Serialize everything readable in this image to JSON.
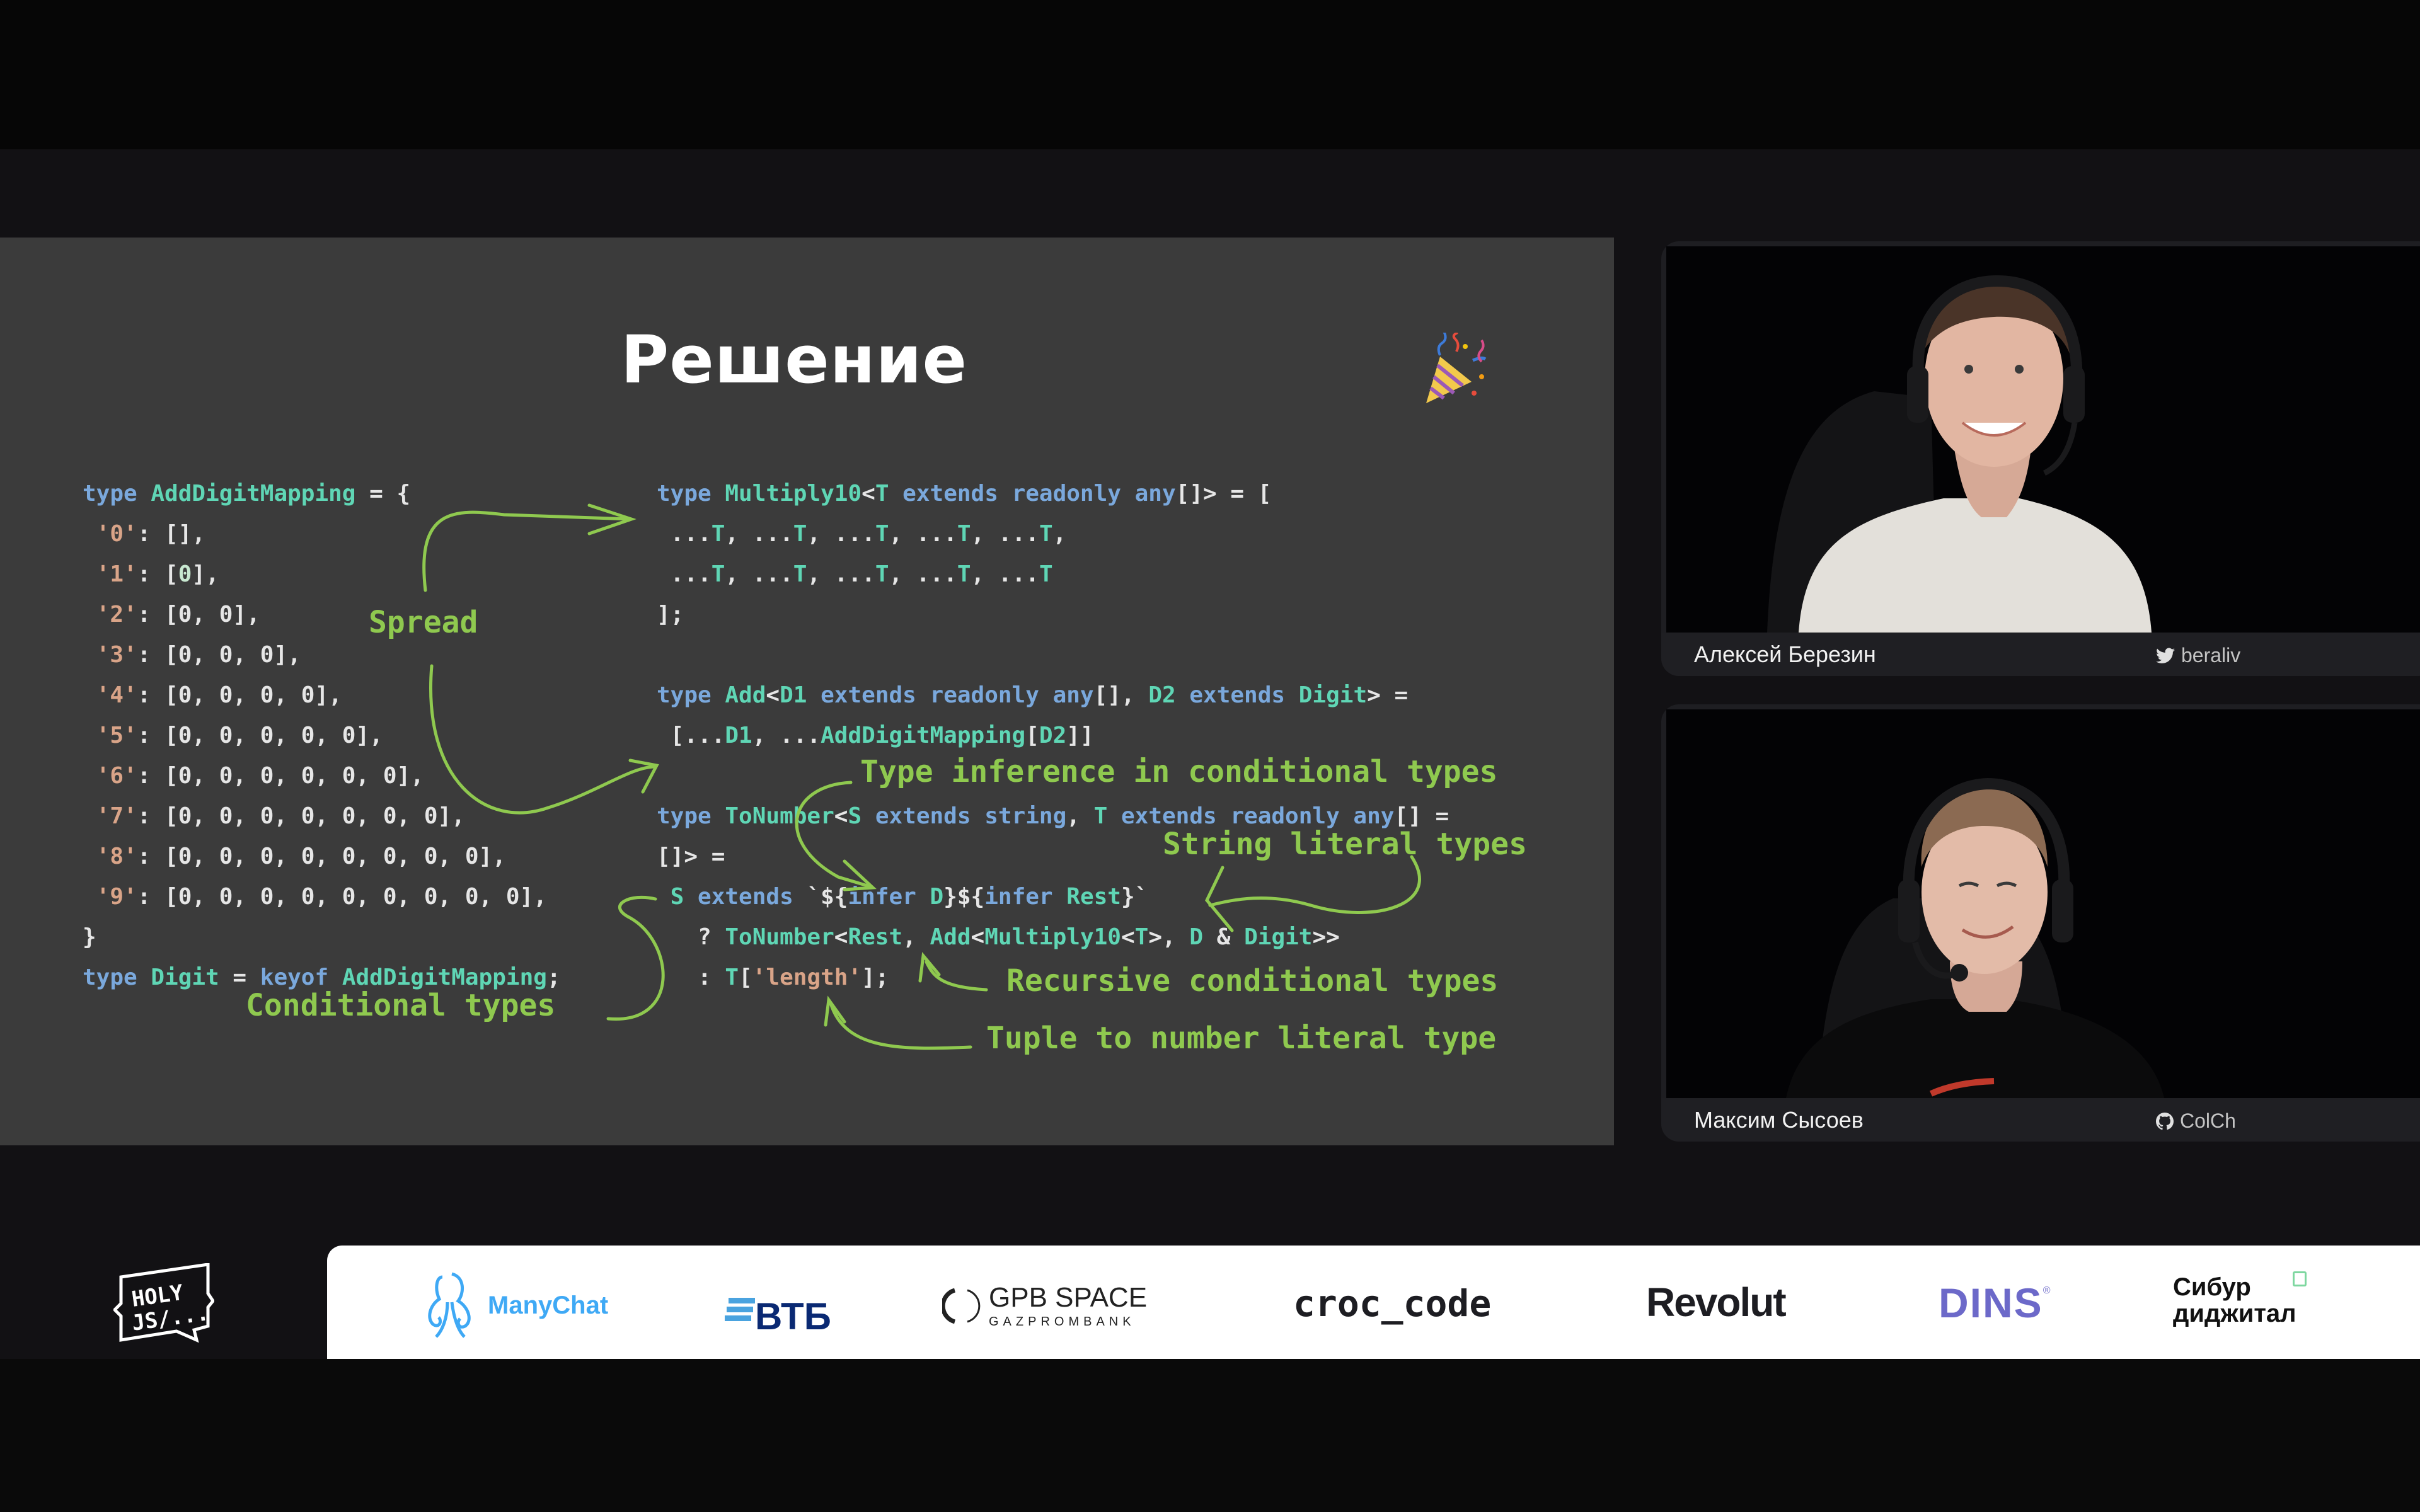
{
  "slide": {
    "title": "Решение",
    "title_icon": "party-popper-icon",
    "left_code": [
      [
        [
          "kw",
          "type "
        ],
        [
          "ty",
          "AddDigitMapping"
        ],
        [
          "tx",
          " = {"
        ]
      ],
      [
        [
          "st",
          " '0'"
        ],
        [
          "tx",
          ": [],"
        ]
      ],
      [
        [
          "st",
          " '1'"
        ],
        [
          "tx",
          ": ["
        ],
        [
          "zr",
          "0"
        ],
        [
          "tx",
          "],"
        ]
      ],
      [
        [
          "st",
          " '2'"
        ],
        [
          "tx",
          ": [0, 0],"
        ]
      ],
      [
        [
          "st",
          " '3'"
        ],
        [
          "tx",
          ": [0, 0, 0],"
        ]
      ],
      [
        [
          "st",
          " '4'"
        ],
        [
          "tx",
          ": [0, 0, 0, 0],"
        ]
      ],
      [
        [
          "st",
          " '5'"
        ],
        [
          "tx",
          ": [0, 0, 0, 0, 0],"
        ]
      ],
      [
        [
          "st",
          " '6'"
        ],
        [
          "tx",
          ": [0, 0, 0, 0, 0, 0],"
        ]
      ],
      [
        [
          "st",
          " '7'"
        ],
        [
          "tx",
          ": [0, 0, 0, 0, 0, 0, 0],"
        ]
      ],
      [
        [
          "st",
          " '8'"
        ],
        [
          "tx",
          ": [0, 0, 0, 0, 0, 0, 0, 0],"
        ]
      ],
      [
        [
          "st",
          " '9'"
        ],
        [
          "tx",
          ": [0, 0, 0, 0, 0, 0, 0, 0, 0],"
        ]
      ],
      [
        [
          "tx",
          "}"
        ]
      ],
      [
        [
          "kw",
          "type "
        ],
        [
          "ty",
          "Digit"
        ],
        [
          "tx",
          " = "
        ],
        [
          "kw",
          "keyof "
        ],
        [
          "ty",
          "AddDigitMapping"
        ],
        [
          "tx",
          ";"
        ]
      ]
    ],
    "multiply_code": [
      [
        [
          "kw",
          "type "
        ],
        [
          "ty",
          "Multiply10"
        ],
        [
          "tx",
          "<"
        ],
        [
          "ty",
          "T"
        ],
        [
          "kw",
          " extends readonly any"
        ],
        [
          "tx",
          "[]> = ["
        ]
      ],
      [
        [
          "tx",
          " ..."
        ],
        [
          "ty",
          "T"
        ],
        [
          "tx",
          ", ..."
        ],
        [
          "ty",
          "T"
        ],
        [
          "tx",
          ", ..."
        ],
        [
          "ty",
          "T"
        ],
        [
          "tx",
          ", ..."
        ],
        [
          "ty",
          "T"
        ],
        [
          "tx",
          ", ..."
        ],
        [
          "ty",
          "T"
        ],
        [
          "tx",
          ","
        ]
      ],
      [
        [
          "tx",
          " ..."
        ],
        [
          "ty",
          "T"
        ],
        [
          "tx",
          ", ..."
        ],
        [
          "ty",
          "T"
        ],
        [
          "tx",
          ", ..."
        ],
        [
          "ty",
          "T"
        ],
        [
          "tx",
          ", ..."
        ],
        [
          "ty",
          "T"
        ],
        [
          "tx",
          ", ..."
        ],
        [
          "ty",
          "T"
        ]
      ],
      [
        [
          "tx",
          "];"
        ]
      ]
    ],
    "add_code": [
      [
        [
          "kw",
          "type "
        ],
        [
          "ty",
          "Add"
        ],
        [
          "tx",
          "<"
        ],
        [
          "ty",
          "D1"
        ],
        [
          "kw",
          " extends readonly any"
        ],
        [
          "tx",
          "[], "
        ],
        [
          "ty",
          "D2"
        ],
        [
          "kw",
          " extends "
        ],
        [
          "ty",
          "Digit"
        ],
        [
          "tx",
          "> ="
        ]
      ],
      [
        [
          "tx",
          " [..."
        ],
        [
          "ty",
          "D1"
        ],
        [
          "tx",
          ", ..."
        ],
        [
          "ty",
          "AddDigitMapping"
        ],
        [
          "tx",
          "["
        ],
        [
          "ty",
          "D2"
        ],
        [
          "tx",
          "]]"
        ]
      ]
    ],
    "tonumber_code": [
      [
        [
          "kw",
          "type "
        ],
        [
          "ty",
          "ToNumber"
        ],
        [
          "tx",
          "<"
        ],
        [
          "ty",
          "S"
        ],
        [
          "kw",
          " extends string"
        ],
        [
          "tx",
          ", "
        ],
        [
          "ty",
          "T"
        ],
        [
          "kw",
          " extends readonly any"
        ],
        [
          "tx",
          "[] ="
        ]
      ],
      [
        [
          "tx",
          "[]> ="
        ]
      ],
      [
        [
          "ty",
          " S"
        ],
        [
          "kw",
          " extends "
        ],
        [
          "tx",
          "`${"
        ],
        [
          "kw",
          "infer "
        ],
        [
          "ty",
          "D"
        ],
        [
          "tx",
          "}${"
        ],
        [
          "kw",
          "infer "
        ],
        [
          "ty",
          "Rest"
        ],
        [
          "tx",
          "}`"
        ]
      ],
      [
        [
          "tx",
          "   ? "
        ],
        [
          "ty",
          "ToNumber"
        ],
        [
          "tx",
          "<"
        ],
        [
          "ty",
          "Rest"
        ],
        [
          "tx",
          ", "
        ],
        [
          "ty",
          "Add"
        ],
        [
          "tx",
          "<"
        ],
        [
          "ty",
          "Multiply10"
        ],
        [
          "tx",
          "<"
        ],
        [
          "ty",
          "T"
        ],
        [
          "tx",
          ">, "
        ],
        [
          "ty",
          "D"
        ],
        [
          "tx",
          " & "
        ],
        [
          "ty",
          "Digit"
        ],
        [
          "tx",
          ">>"
        ]
      ],
      [
        [
          "tx",
          "   : "
        ],
        [
          "ty",
          "T"
        ],
        [
          "tx",
          "["
        ],
        [
          "st",
          "'length'"
        ],
        [
          "tx",
          "];"
        ]
      ]
    ],
    "annotations": {
      "spread": "Spread",
      "conditional": "Conditional types",
      "inference": "Type inference in conditional types",
      "string_literal": "String literal types",
      "recursive": "Recursive conditional types",
      "tuple": "Tuple to number literal type"
    },
    "colors": {
      "background": "#3b3b3b",
      "keyword": "#7aa8dc",
      "type": "#5fd6b5",
      "string": "#d9a488",
      "text": "#e6e6e6",
      "annotation": "#8fc94f"
    }
  },
  "speakers": [
    {
      "name": "Алексей Березин",
      "handle": "beraliv",
      "handle_icon": "twitter-icon",
      "shirt": "white"
    },
    {
      "name": "Максим Сысоев",
      "handle": "ColCh",
      "handle_icon": "github-icon",
      "shirt": "black"
    }
  ],
  "conference_logo": {
    "line1": "HOLY",
    "line2": "JS/..."
  },
  "sponsors": [
    {
      "name": "ManyChat",
      "color": "#3fa9f5"
    },
    {
      "name": "ВТБ",
      "color": "#0a2973"
    },
    {
      "name": "GPB SPACE",
      "sub": "GAZPROMBANK",
      "color": "#222222"
    },
    {
      "name": "croc_code",
      "color": "#1d1d22"
    },
    {
      "name": "Revolut",
      "color": "#1d1d22"
    },
    {
      "name": "DINS",
      "color": "#6c69c9"
    },
    {
      "name": "Сибур",
      "sub": "диджитал",
      "color": "#111111"
    }
  ]
}
